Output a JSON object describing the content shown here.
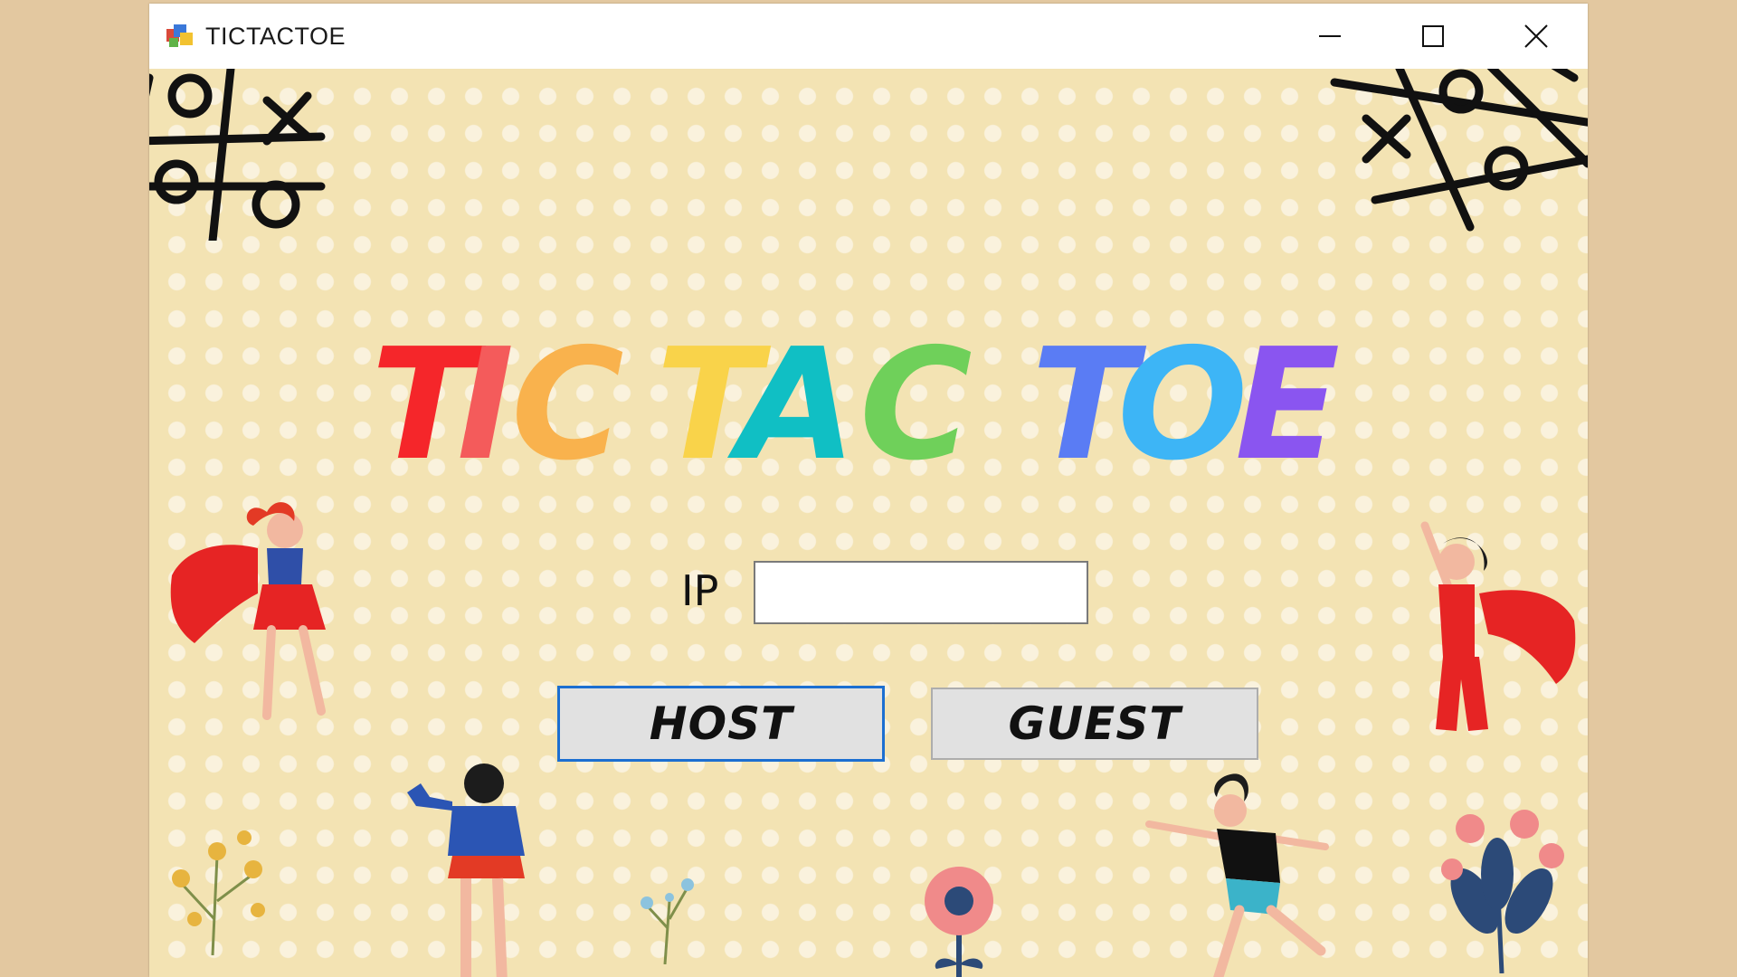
{
  "window": {
    "title": "TICTACTOE",
    "controls": {
      "minimize": "minimize-icon",
      "maximize": "maximize-icon",
      "close": "close-icon"
    }
  },
  "main": {
    "game_title": "TIC TAC TOE",
    "ip_label": "IP",
    "ip_value": "",
    "host_label": "HOST",
    "guest_label": "GUEST"
  },
  "colors": {
    "background": "#f3e3b3",
    "title_letters": [
      "#f5262a",
      "#f45b5b",
      "#f9b24d",
      "#f9d34a",
      "#10bfc4",
      "#6fd05a",
      "#5a7cf4",
      "#3db5f6",
      "#8a55f0"
    ],
    "host_focus_border": "#1c6fd1"
  }
}
